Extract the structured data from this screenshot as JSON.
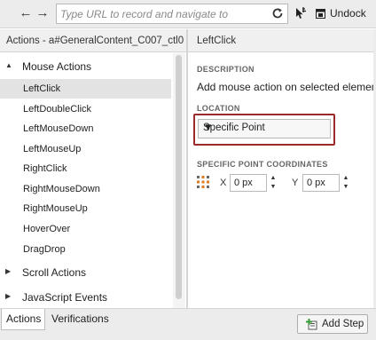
{
  "toolbar": {
    "back_glyph": "←",
    "forward_glyph": "→",
    "url_placeholder": "Type URL to record and navigate to",
    "url_value": "",
    "undock_label": "Undock",
    "icons": [
      "back-arrow-icon",
      "forward-arrow-icon",
      "refresh-icon",
      "record-pointer-icon",
      "undock-icon"
    ]
  },
  "left_panel": {
    "header": "Actions - a#GeneralContent_C007_ctl0...",
    "groups": [
      {
        "label": "Mouse Actions",
        "caret": "▲",
        "items": [
          "LeftClick",
          "LeftDoubleClick",
          "LeftMouseDown",
          "LeftMouseUp",
          "RightClick",
          "RightMouseDown",
          "RightMouseUp",
          "HoverOver",
          "DragDrop"
        ]
      },
      {
        "label": "Scroll Actions",
        "caret": "▶",
        "items": []
      },
      {
        "label": "JavaScript Events",
        "caret": "▶",
        "items": []
      }
    ],
    "selected_item": "LeftClick"
  },
  "right_panel": {
    "header": "LeftClick",
    "description_label": "DESCRIPTION",
    "description_text": "Add mouse action on selected element",
    "location_label": "LOCATION",
    "location_value": "Specific Point",
    "location_caret": "▼",
    "coords_label": "SPECIFIC POINT COORDINATES",
    "x_label": "X",
    "x_value": "0 px",
    "y_label": "Y",
    "y_value": "0 px",
    "spin_up": "▲",
    "spin_down": "▼"
  },
  "bottom": {
    "tabs": [
      "Actions",
      "Verifications"
    ],
    "active_tab": "Actions",
    "add_step_label": "Add Step"
  },
  "colors": {
    "highlight_frame": "#9b2b2b",
    "selected_row": "#e3e3e3",
    "toolbar_bg": "#ececec",
    "add_step_icon": "#3a9a3a"
  }
}
